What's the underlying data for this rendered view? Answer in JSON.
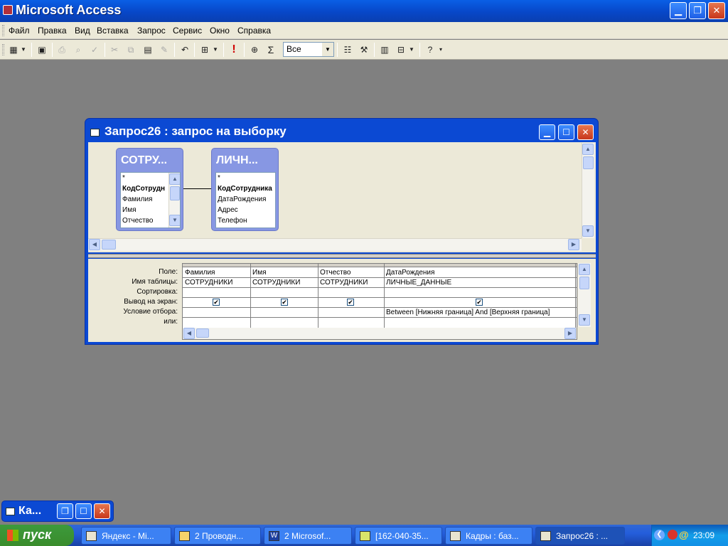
{
  "app": {
    "title": "Microsoft Access"
  },
  "menu": [
    "Файл",
    "Правка",
    "Вид",
    "Вставка",
    "Запрос",
    "Сервис",
    "Окно",
    "Справка"
  ],
  "toolbar": {
    "combo_value": "Все",
    "sigma": "Σ",
    "exclaim": "!"
  },
  "query_window": {
    "title": "Запрос26 : запрос на выборку",
    "tables": [
      {
        "name": "СОТРУ...",
        "fields": [
          "*",
          "КодСотрудн",
          "Фамилия",
          "Имя",
          "Отчество"
        ]
      },
      {
        "name": "ЛИЧН...",
        "fields": [
          "*",
          "КодСотрудника",
          "ДатаРождения",
          "Адрес",
          "Телефон"
        ]
      }
    ],
    "row_labels": [
      "Поле:",
      "Имя таблицы:",
      "Сортировка:",
      "Вывод на экран:",
      "Условие отбора:",
      "или:"
    ],
    "columns": [
      {
        "field": "Фамилия",
        "table": "СОТРУДНИКИ",
        "sort": "",
        "show": true,
        "criteria": ""
      },
      {
        "field": "Имя",
        "table": "СОТРУДНИКИ",
        "sort": "",
        "show": true,
        "criteria": ""
      },
      {
        "field": "Отчество",
        "table": "СОТРУДНИКИ",
        "sort": "",
        "show": true,
        "criteria": ""
      },
      {
        "field": "ДатаРождения",
        "table": "ЛИЧНЫЕ_ДАННЫЕ",
        "sort": "",
        "show": true,
        "criteria": "Between [Нижняя граница] And [Верхняя граница]"
      }
    ],
    "check_glyph": "✔"
  },
  "minimized_window": {
    "title": "Ка..."
  },
  "taskbar": {
    "start": "пуск",
    "tasks": [
      "Яндекс - Mi...",
      "2 Проводн...",
      "2 Microsof...",
      "[162-040-35...",
      "Кадры : баз...",
      "Запрос26 : ..."
    ],
    "clock": "23:09"
  }
}
